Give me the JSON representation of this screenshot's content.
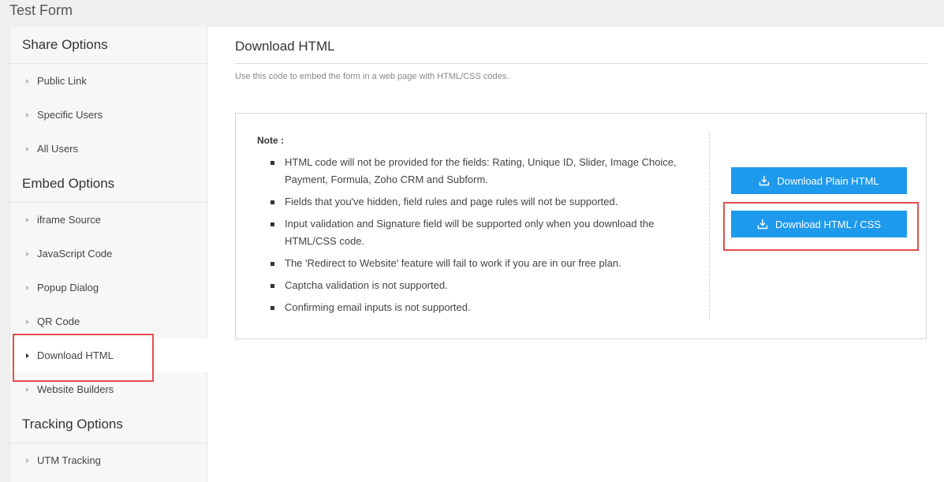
{
  "window": {
    "title": "Test Form"
  },
  "sidebar": {
    "share_header": "Share Options",
    "share_items": [
      "Public Link",
      "Specific Users",
      "All Users"
    ],
    "embed_header": "Embed Options",
    "embed_items": [
      "iframe Source",
      "JavaScript Code",
      "Popup Dialog",
      "QR Code",
      "Download HTML",
      "Website Builders"
    ],
    "tracking_header": "Tracking Options",
    "tracking_items": [
      "UTM Tracking"
    ],
    "active_item": "Download HTML"
  },
  "main": {
    "title": "Download HTML",
    "description": "Use this code to embed the form in a web page with HTML/CSS codes.",
    "note": {
      "label": "Note :",
      "items": [
        "HTML code will not be provided for the fields: Rating, Unique ID, Slider, Image Choice, Payment, Formula, Zoho CRM and Subform.",
        "Fields that you've hidden, field rules and page rules will not be supported.",
        "Input validation and Signature field will be supported only when you download the HTML/CSS code.",
        "The 'Redirect to Website' feature will fail to work if you are in our free plan.",
        "Captcha validation is not supported.",
        "Confirming email inputs is not supported."
      ]
    },
    "buttons": {
      "plain_html": "Download Plain HTML",
      "html_css": "Download HTML / CSS"
    }
  },
  "colors": {
    "accent_button": "#1e9aed",
    "highlight": "#e84c4c"
  },
  "icons": {
    "download": "download-icon",
    "caret": "caret-right-icon"
  }
}
